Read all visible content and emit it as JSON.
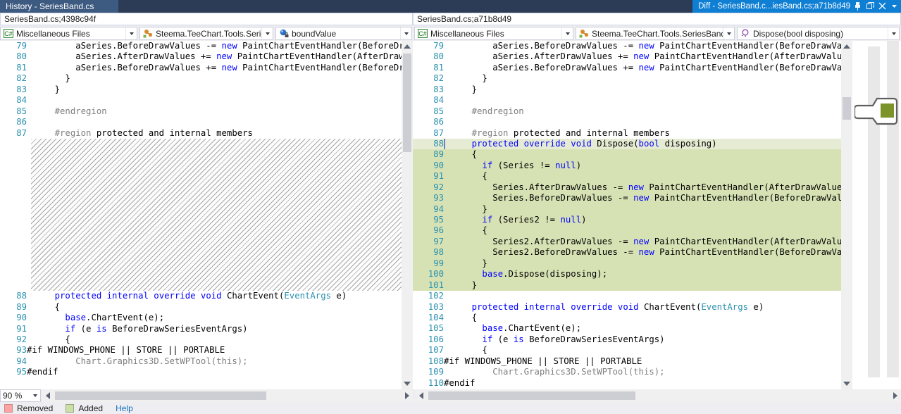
{
  "window": {
    "history_tab_label": "History - SeriesBand.cs",
    "diff_tab_label": "Diff - SeriesBand.c...iesBand.cs;a71b8d49",
    "pin_icon": "pin-icon",
    "float_icon": "float-window-icon",
    "close_icon": "close-icon",
    "chevron_icon": "chevron-down-icon",
    "accent_active_tab": "#0f7fd4",
    "accent_titlebar": "#2d3c56"
  },
  "left_pane": {
    "path": "SeriesBand.cs;4398c94f",
    "project_combo": {
      "label": "Miscellaneous Files",
      "icon": "csharp-project-icon"
    },
    "type_combo": {
      "label": "Steema.TeeChart.Tools.SeriesB",
      "icon": "class-icon"
    },
    "member_combo": {
      "label": "boundValue",
      "icon": "field-private-icon"
    },
    "zoom_level": "90 %"
  },
  "right_pane": {
    "path": "SeriesBand.cs;a71b8d49",
    "project_combo": {
      "label": "Miscellaneous Files",
      "icon": "csharp-project-icon"
    },
    "type_combo": {
      "label": "Steema.TeeChart.Tools.SeriesBandTo",
      "icon": "class-icon"
    },
    "member_combo": {
      "label": "Dispose(bool disposing)",
      "icon": "method-protected-icon"
    }
  },
  "left_code": [
    {
      "n": "79",
      "segs": [
        {
          "t": "        aSeries.BeforeDrawValues -= ",
          "c": ""
        },
        {
          "t": "new",
          "c": "k"
        },
        {
          "t": " PaintChartEventHandler(BeforeDrawValues);",
          "c": ""
        }
      ]
    },
    {
      "n": "80",
      "segs": [
        {
          "t": "        aSeries.AfterDrawValues += ",
          "c": ""
        },
        {
          "t": "new",
          "c": "k"
        },
        {
          "t": " PaintChartEventHandler(AfterDrawValues);",
          "c": ""
        }
      ]
    },
    {
      "n": "81",
      "segs": [
        {
          "t": "        aSeries.BeforeDrawValues += ",
          "c": ""
        },
        {
          "t": "new",
          "c": "k"
        },
        {
          "t": " PaintChartEventHandler(BeforeDrawValues);",
          "c": ""
        }
      ]
    },
    {
      "n": "82",
      "segs": [
        {
          "t": "      }",
          "c": ""
        }
      ]
    },
    {
      "n": "83",
      "segs": [
        {
          "t": "    }",
          "c": ""
        }
      ]
    },
    {
      "n": "84",
      "segs": [
        {
          "t": "",
          "c": ""
        }
      ]
    },
    {
      "n": "85",
      "segs": [
        {
          "t": "    #endregion",
          "c": "pp"
        }
      ]
    },
    {
      "n": "86",
      "segs": [
        {
          "t": "",
          "c": ""
        }
      ]
    },
    {
      "n": "87",
      "segs": [
        {
          "t": "    #region",
          "c": "pp"
        },
        {
          "t": " protected and internal members",
          "c": ""
        }
      ]
    }
  ],
  "left_code_after": [
    {
      "n": "88",
      "segs": [
        {
          "t": "    ",
          "c": ""
        },
        {
          "t": "protected internal override void",
          "c": "k"
        },
        {
          "t": " ChartEvent(",
          "c": ""
        },
        {
          "t": "EventArgs",
          "c": "t"
        },
        {
          "t": " e)",
          "c": ""
        }
      ]
    },
    {
      "n": "89",
      "segs": [
        {
          "t": "    {",
          "c": ""
        }
      ]
    },
    {
      "n": "90",
      "segs": [
        {
          "t": "      ",
          "c": ""
        },
        {
          "t": "base",
          "c": "k"
        },
        {
          "t": ".ChartEvent(e);",
          "c": ""
        }
      ]
    },
    {
      "n": "91",
      "segs": [
        {
          "t": "      ",
          "c": ""
        },
        {
          "t": "if",
          "c": "k"
        },
        {
          "t": " (e ",
          "c": ""
        },
        {
          "t": "is",
          "c": "k"
        },
        {
          "t": " BeforeDrawSeriesEventArgs)",
          "c": ""
        }
      ]
    },
    {
      "n": "92",
      "segs": [
        {
          "t": "      {",
          "c": ""
        }
      ]
    },
    {
      "n": "93",
      "segs": [
        {
          "t": "#if WINDOWS_PHONE || STORE || PORTABLE",
          "c": "pk"
        }
      ],
      "nogutterindent": true
    },
    {
      "n": "94",
      "segs": [
        {
          "t": "        Chart.Graphics3D.SetWPTool(this);",
          "c": "dim"
        }
      ]
    },
    {
      "n": "95",
      "segs": [
        {
          "t": "#endif",
          "c": "pk"
        }
      ],
      "nogutterindent": true
    }
  ],
  "right_code": [
    {
      "n": "79",
      "hl": "none",
      "segs": [
        {
          "t": "        aSeries.BeforeDrawValues -= ",
          "c": ""
        },
        {
          "t": "new",
          "c": "k"
        },
        {
          "t": " PaintChartEventHandler(BeforeDrawValues);",
          "c": ""
        }
      ]
    },
    {
      "n": "80",
      "hl": "none",
      "segs": [
        {
          "t": "        aSeries.AfterDrawValues += ",
          "c": ""
        },
        {
          "t": "new",
          "c": "k"
        },
        {
          "t": " PaintChartEventHandler(AfterDrawValues);",
          "c": ""
        }
      ]
    },
    {
      "n": "81",
      "hl": "none",
      "segs": [
        {
          "t": "        aSeries.BeforeDrawValues += ",
          "c": ""
        },
        {
          "t": "new",
          "c": "k"
        },
        {
          "t": " PaintChartEventHandler(BeforeDrawValues);",
          "c": ""
        }
      ]
    },
    {
      "n": "82",
      "hl": "none",
      "segs": [
        {
          "t": "      }",
          "c": ""
        }
      ]
    },
    {
      "n": "83",
      "hl": "none",
      "segs": [
        {
          "t": "    }",
          "c": ""
        }
      ]
    },
    {
      "n": "84",
      "hl": "none",
      "segs": [
        {
          "t": "",
          "c": ""
        }
      ]
    },
    {
      "n": "85",
      "hl": "none",
      "segs": [
        {
          "t": "    #endregion",
          "c": "pp"
        }
      ]
    },
    {
      "n": "86",
      "hl": "none",
      "segs": [
        {
          "t": "",
          "c": ""
        }
      ]
    },
    {
      "n": "87",
      "hl": "none",
      "segs": [
        {
          "t": "    #region",
          "c": "pp"
        },
        {
          "t": " protected and internal members",
          "c": ""
        }
      ]
    },
    {
      "n": "88",
      "hl": "first",
      "segs": [
        {
          "t": "    ",
          "c": ""
        },
        {
          "t": "protected override void",
          "c": "k"
        },
        {
          "t": " Dispose(",
          "c": ""
        },
        {
          "t": "bool",
          "c": "k"
        },
        {
          "t": " disposing)",
          "c": ""
        }
      ]
    },
    {
      "n": "89",
      "hl": "add",
      "segs": [
        {
          "t": "    {",
          "c": ""
        }
      ]
    },
    {
      "n": "90",
      "hl": "add",
      "segs": [
        {
          "t": "      ",
          "c": ""
        },
        {
          "t": "if",
          "c": "k"
        },
        {
          "t": " (Series != ",
          "c": ""
        },
        {
          "t": "null",
          "c": "k"
        },
        {
          "t": ")",
          "c": ""
        }
      ]
    },
    {
      "n": "91",
      "hl": "add",
      "segs": [
        {
          "t": "      {",
          "c": ""
        }
      ]
    },
    {
      "n": "92",
      "hl": "add",
      "segs": [
        {
          "t": "        Series.AfterDrawValues -= ",
          "c": ""
        },
        {
          "t": "new",
          "c": "k"
        },
        {
          "t": " PaintChartEventHandler(AfterDrawValues);",
          "c": ""
        }
      ]
    },
    {
      "n": "93",
      "hl": "add",
      "segs": [
        {
          "t": "        Series.BeforeDrawValues -= ",
          "c": ""
        },
        {
          "t": "new",
          "c": "k"
        },
        {
          "t": " PaintChartEventHandler(BeforeDrawValues);",
          "c": ""
        }
      ]
    },
    {
      "n": "94",
      "hl": "add",
      "segs": [
        {
          "t": "      }",
          "c": ""
        }
      ]
    },
    {
      "n": "95",
      "hl": "add",
      "segs": [
        {
          "t": "      ",
          "c": ""
        },
        {
          "t": "if",
          "c": "k"
        },
        {
          "t": " (Series2 != ",
          "c": ""
        },
        {
          "t": "null",
          "c": "k"
        },
        {
          "t": ")",
          "c": ""
        }
      ]
    },
    {
      "n": "96",
      "hl": "add",
      "segs": [
        {
          "t": "      {",
          "c": ""
        }
      ]
    },
    {
      "n": "97",
      "hl": "add",
      "segs": [
        {
          "t": "        Series2.AfterDrawValues -= ",
          "c": ""
        },
        {
          "t": "new",
          "c": "k"
        },
        {
          "t": " PaintChartEventHandler(AfterDrawValues);",
          "c": ""
        }
      ]
    },
    {
      "n": "98",
      "hl": "add",
      "segs": [
        {
          "t": "        Series2.BeforeDrawValues -= ",
          "c": ""
        },
        {
          "t": "new",
          "c": "k"
        },
        {
          "t": " PaintChartEventHandler(BeforeDrawValues);",
          "c": ""
        }
      ]
    },
    {
      "n": "99",
      "hl": "add",
      "segs": [
        {
          "t": "      }",
          "c": ""
        }
      ]
    },
    {
      "n": "100",
      "hl": "add",
      "segs": [
        {
          "t": "      ",
          "c": ""
        },
        {
          "t": "base",
          "c": "k"
        },
        {
          "t": ".Dispose(disposing);",
          "c": ""
        }
      ]
    },
    {
      "n": "101",
      "hl": "add",
      "segs": [
        {
          "t": "    }",
          "c": ""
        }
      ]
    },
    {
      "n": "102",
      "hl": "none",
      "segs": [
        {
          "t": "",
          "c": ""
        }
      ]
    },
    {
      "n": "103",
      "hl": "none",
      "segs": [
        {
          "t": "    ",
          "c": ""
        },
        {
          "t": "protected internal override void",
          "c": "k"
        },
        {
          "t": " ChartEvent(",
          "c": ""
        },
        {
          "t": "EventArgs",
          "c": "t"
        },
        {
          "t": " e)",
          "c": ""
        }
      ]
    },
    {
      "n": "104",
      "hl": "none",
      "segs": [
        {
          "t": "    {",
          "c": ""
        }
      ]
    },
    {
      "n": "105",
      "hl": "none",
      "segs": [
        {
          "t": "      ",
          "c": ""
        },
        {
          "t": "base",
          "c": "k"
        },
        {
          "t": ".ChartEvent(e);",
          "c": ""
        }
      ]
    },
    {
      "n": "106",
      "hl": "none",
      "segs": [
        {
          "t": "      ",
          "c": ""
        },
        {
          "t": "if",
          "c": "k"
        },
        {
          "t": " (e ",
          "c": ""
        },
        {
          "t": "is",
          "c": "k"
        },
        {
          "t": " BeforeDrawSeriesEventArgs)",
          "c": ""
        }
      ]
    },
    {
      "n": "107",
      "hl": "none",
      "segs": [
        {
          "t": "      {",
          "c": ""
        }
      ]
    },
    {
      "n": "108",
      "hl": "none",
      "nogutterindent": true,
      "segs": [
        {
          "t": "#if WINDOWS_PHONE || STORE || PORTABLE",
          "c": "pk"
        }
      ]
    },
    {
      "n": "109",
      "hl": "none",
      "segs": [
        {
          "t": "        Chart.Graphics3D.SetWPTool(this);",
          "c": "dim"
        }
      ]
    },
    {
      "n": "110",
      "hl": "none",
      "nogutterindent": true,
      "segs": [
        {
          "t": "#endif",
          "c": "pk"
        }
      ]
    }
  ],
  "legend": {
    "removed_label": "Removed",
    "added_label": "Added",
    "help_label": "Help",
    "removed_color": "#ffa3a3",
    "added_color": "#cddfa8",
    "help_color": "#1570c1"
  },
  "overview": {
    "change_marker_color": "#7b9329"
  }
}
